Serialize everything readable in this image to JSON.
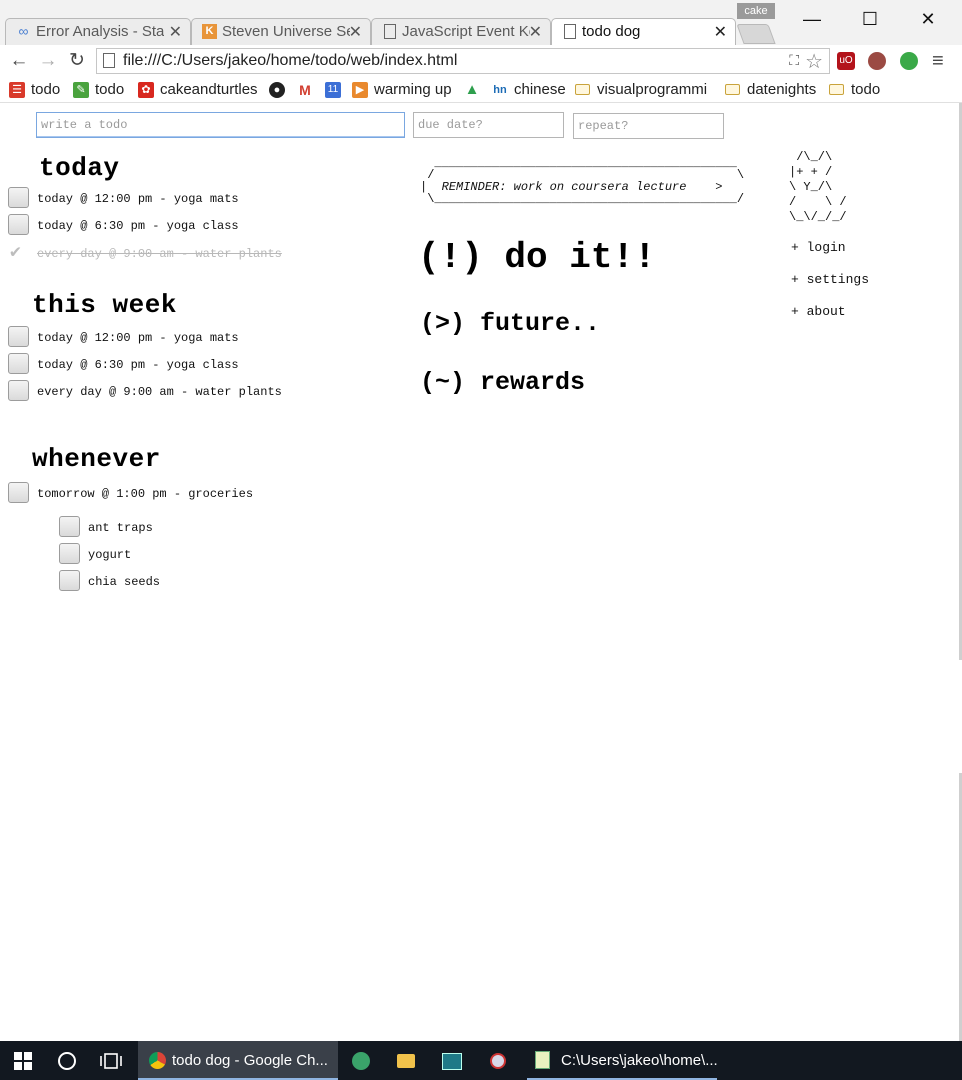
{
  "browser": {
    "profile_name": "cake",
    "tabs": [
      {
        "icon": "link-icon",
        "label": "Error Analysis - Star"
      },
      {
        "icon": "k-icon",
        "label": "Steven Universe Se"
      },
      {
        "icon": "page-icon",
        "label": "JavaScript Event Ke"
      },
      {
        "icon": "page-icon",
        "label": "todo dog",
        "active": true
      }
    ],
    "window_buttons": {
      "minimize": "—",
      "maximize": "☐",
      "close": "✕"
    },
    "url": "file:///C:/Users/jakeo/home/todo/web/index.html",
    "bookmarks": [
      {
        "icon": "todoist-icon",
        "label": "todo"
      },
      {
        "icon": "evernote-icon",
        "label": "todo"
      },
      {
        "icon": "cake-icon",
        "label": "cakeandturtles"
      },
      {
        "icon": "github-icon",
        "label": ""
      },
      {
        "icon": "gmail-icon",
        "label": ""
      },
      {
        "icon": "calendar-icon",
        "label": ""
      },
      {
        "icon": "bookmark-icon",
        "label": "warming up"
      },
      {
        "icon": "drive-icon",
        "label": ""
      },
      {
        "icon": "hn-icon",
        "label": "chinese"
      },
      {
        "icon": "folder-icon",
        "label": "visualprogrammi"
      },
      {
        "icon": "folder-icon",
        "label": "datenights"
      },
      {
        "icon": "folder-icon",
        "label": "todo"
      }
    ],
    "calendar_number": "11"
  },
  "page": {
    "inputs": {
      "todo_placeholder": "write a todo",
      "due_placeholder": "due date?",
      "repeat_placeholder": "repeat?"
    },
    "sections": {
      "today": {
        "title": "today",
        "items": [
          {
            "text": "today @ 12:00 pm - yoga mats",
            "done": false
          },
          {
            "text": "today @ 6:30 pm - yoga class",
            "done": false
          },
          {
            "text": "every day @ 9:00 am - water plants",
            "done": true
          }
        ]
      },
      "this_week": {
        "title": "this week",
        "items": [
          {
            "text": "today @ 12:00 pm - yoga mats",
            "done": false
          },
          {
            "text": "today @ 6:30 pm - yoga class",
            "done": false
          },
          {
            "text": "every day @ 9:00 am - water plants",
            "done": false
          }
        ]
      },
      "whenever": {
        "title": "whenever",
        "items": [
          {
            "text": "tomorrow @ 1:00 pm - groceries",
            "done": false
          }
        ],
        "subitems": [
          {
            "text": "ant traps",
            "done": false
          },
          {
            "text": "yogurt",
            "done": false
          },
          {
            "text": "chia seeds",
            "done": false
          }
        ]
      }
    },
    "reminder": {
      "top": "  __________________________________________",
      "line1": " /                                          \\",
      "prefix": "|  ",
      "message": "REMINDER: work on coursera lecture",
      "suffix": "    >",
      "bottom": " \\__________________________________________/"
    },
    "categories": {
      "do_it": "(!) do it!!",
      "future": "(>) future..",
      "rewards": "(~) rewards"
    },
    "ascii_dog": " /\\_/\\\n|+ + /\n\\ Y_/\\\n/    \\ /\n\\_\\/_/_/",
    "nav": {
      "login": "+ login",
      "settings": "+ settings",
      "about": "+ about"
    }
  },
  "taskbar": {
    "chrome_label": "todo dog - Google Ch...",
    "notepad_label": "C:\\Users\\jakeo\\home\\..."
  }
}
